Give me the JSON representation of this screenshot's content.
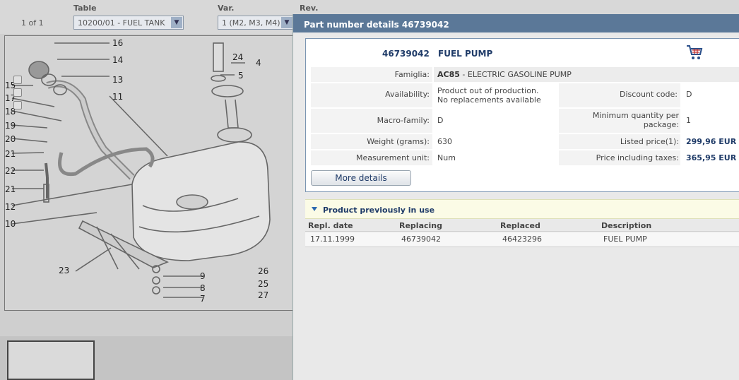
{
  "background": {
    "page_indicator": "1 of 1",
    "columns": {
      "table": "Table",
      "var": "Var.",
      "rev": "Rev."
    },
    "table_select": "10200/01 - FUEL TANK",
    "var_select": "1 (M2, M3, M4)",
    "drawing_labels": [
      "16",
      "14",
      "13",
      "15",
      "17",
      "18",
      "19",
      "20",
      "21",
      "22",
      "21",
      "12",
      "10",
      "11",
      "24",
      "5",
      "4",
      "23",
      "9",
      "8",
      "7",
      "26",
      "25",
      "27"
    ]
  },
  "panel": {
    "title": "Part number details 46739042",
    "part_number": "46739042",
    "part_name": "FUEL PUMP",
    "cart_icon": "shopping-cart-icon",
    "famiglia_label": "Famiglia:",
    "famiglia_code": "AC85",
    "famiglia_desc": " - ELECTRIC GASOLINE PUMP",
    "availability_label": "Availability:",
    "availability_line1": "Product out of production.",
    "availability_line2": "No replacements available",
    "discount_label": "Discount code:",
    "discount_value": "D",
    "macro_label": "Macro-family:",
    "macro_value": "D",
    "minqty_label_1": "Minimum quantity per",
    "minqty_label_2": "package:",
    "minqty_value": "1",
    "weight_label": "Weight (grams):",
    "weight_value": "630",
    "listed_label": "Listed price(1):",
    "listed_value": "299,96 EUR",
    "unit_label": "Measurement unit:",
    "unit_value": "Num",
    "taxes_label": "Price including taxes:",
    "taxes_value": "365,95 EUR",
    "more_details": "More details"
  },
  "previous": {
    "title": "Product previously in use",
    "headers": [
      "Repl. date",
      "Replacing",
      "Replaced",
      "Description"
    ],
    "rows": [
      [
        "17.11.1999",
        "46739042",
        "46423296",
        "FUEL PUMP"
      ]
    ]
  },
  "colors": {
    "header": "#5b7898",
    "accent": "#1f3b68",
    "card_border": "#7b95b2"
  }
}
